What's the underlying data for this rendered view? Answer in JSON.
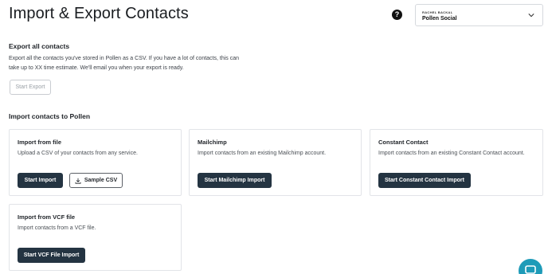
{
  "header": {
    "title": "Import & Export Contacts",
    "help_icon": "question-circle-icon",
    "account": {
      "user_name": "RACHEL BACKAL",
      "org_name": "Pollen Social"
    }
  },
  "export": {
    "heading": "Export all contacts",
    "description": "Export all the contacts you've stored in Pollen as a CSV. If you have a lot of contacts, this can take up to XX time estimate. We'll email you when your export is ready.",
    "button_label": "Start Export"
  },
  "import": {
    "heading": "Import contacts to Pollen",
    "cards": [
      {
        "title": "Import from file",
        "description": "Upload a CSV of your contacts from any service.",
        "primary_label": "Start Import",
        "secondary_label": "Sample CSV"
      },
      {
        "title": "Mailchimp",
        "description": "Import contacts from an existing Mailchimp account.",
        "primary_label": "Start Mailchimp Import"
      },
      {
        "title": "Constant Contact",
        "description": "Import contacts from an existing Constant Contact account.",
        "primary_label": "Start Constant Contact Import"
      },
      {
        "title": "Import from VCF file",
        "description": "Import contacts from a VCF file.",
        "primary_label": "Start VCF File Import"
      }
    ]
  },
  "colors": {
    "primary_button": "#243442",
    "chat_launcher": "#1e9bb8"
  }
}
